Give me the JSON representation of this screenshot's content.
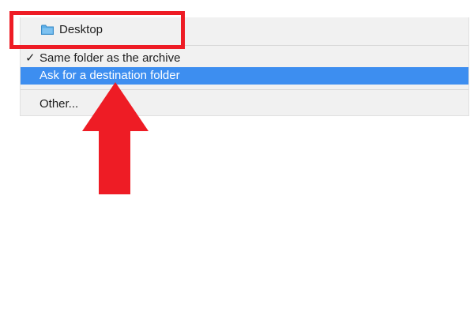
{
  "menu": {
    "desktop_label": "Desktop",
    "checkmark": "✓",
    "same_folder_label": "Same folder as the archive",
    "ask_destination_label": "Ask for a destination folder",
    "other_label": "Other..."
  },
  "icons": {
    "folder": "folder-icon",
    "arrow": "up-arrow-annotation"
  },
  "colors": {
    "highlight_red": "#ee1c25",
    "selection_blue": "#3d8ef0",
    "menu_background": "#f1f1f1"
  }
}
